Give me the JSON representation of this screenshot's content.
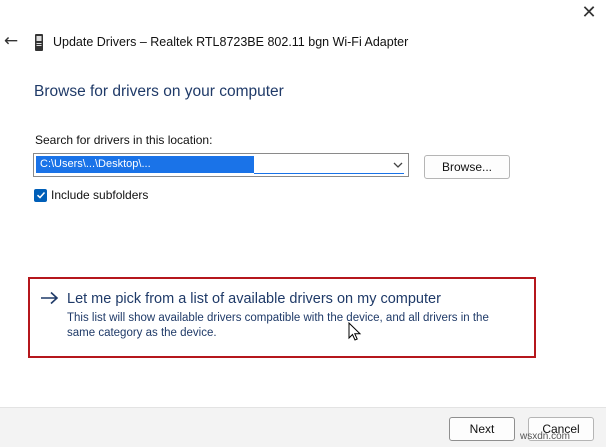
{
  "header": {
    "close_glyph": "✕",
    "back_glyph": "←",
    "title": "Update Drivers – Realtek RTL8723BE 802.11 bgn Wi-Fi Adapter",
    "device_icon": "device-icon"
  },
  "main": {
    "page_title": "Browse for drivers on your computer",
    "search_label": "Search for drivers in this location:",
    "path_value": "C:\\Users\\...\\Desktop\\...",
    "browse_label": "Browse...",
    "include_subfolders_label": "Include subfolders",
    "include_subfolders_checked": true
  },
  "option": {
    "title": "Let me pick from a list of available drivers on my computer",
    "description": "This list will show available drivers compatible with the device, and all drivers in the same category as the device.",
    "highlight_color": "#b5171c"
  },
  "footer": {
    "next_label": "Next",
    "cancel_label": "Cancel"
  },
  "watermark": "wsxdn.com",
  "colors": {
    "accent": "#005fb8",
    "link_text": "#1f3a68",
    "selection": "#1a73e8"
  }
}
